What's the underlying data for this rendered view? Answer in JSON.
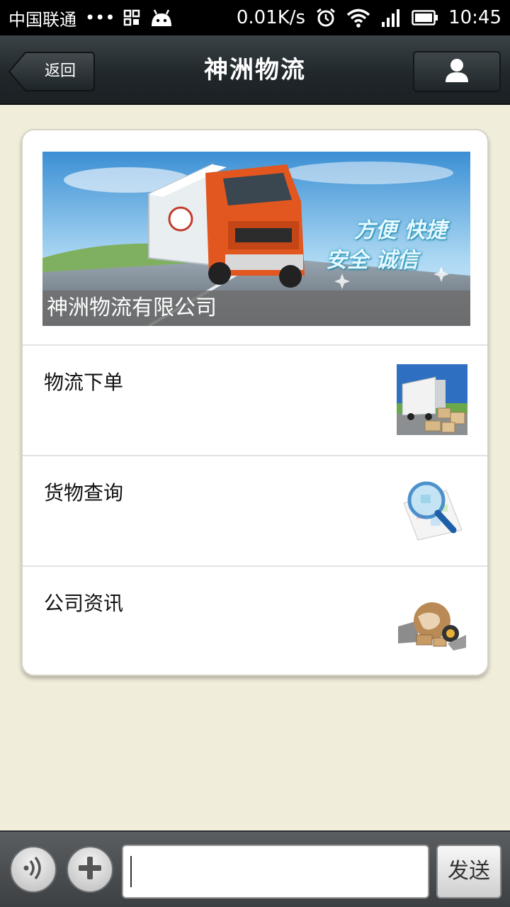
{
  "status_bar": {
    "carrier": "中国联通",
    "dots": "•••",
    "speed": "0.01K/s",
    "time": "10:45"
  },
  "header": {
    "title": "神洲物流",
    "back_label": "返回",
    "profile_icon": "person-icon"
  },
  "banner": {
    "slogan_line1": "方便 快捷",
    "slogan_line2": "安全 诚信",
    "caption": "神洲物流有限公司"
  },
  "menu": {
    "items": [
      {
        "label": "物流下单",
        "icon": "truck-boxes-thumbnail"
      },
      {
        "label": "货物查询",
        "icon": "magnifier-map-thumbnail"
      },
      {
        "label": "公司资讯",
        "icon": "globe-logistics-thumbnail"
      }
    ]
  },
  "input_bar": {
    "voice_icon": "voice-icon",
    "plus_icon": "plus-icon",
    "input_value": "",
    "send_label": "发送"
  },
  "colors": {
    "background": "#f1eddb",
    "titlebar": "#21282b",
    "card": "#ffffff",
    "bottombar": "#4a4e51"
  }
}
